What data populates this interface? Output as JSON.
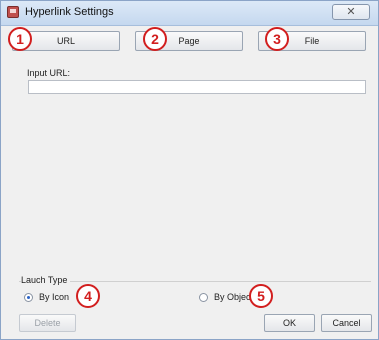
{
  "window": {
    "title": "Hyperlink Settings",
    "close_symbol": "✕"
  },
  "tabs": [
    {
      "label": "URL",
      "badge": "1"
    },
    {
      "label": "Page",
      "badge": "2"
    },
    {
      "label": "File",
      "badge": "3"
    }
  ],
  "url_section": {
    "label": "Input URL:",
    "value": ""
  },
  "launch_type": {
    "label": "Lauch Type",
    "options": [
      {
        "label": "By Icon",
        "badge": "4",
        "checked": true
      },
      {
        "label": "By Object",
        "badge": "5",
        "checked": false
      }
    ]
  },
  "buttons": {
    "delete": "Delete",
    "ok": "OK",
    "cancel": "Cancel"
  },
  "colors": {
    "badge": "#d21e1e",
    "radio_selected": "#2a63c6"
  }
}
